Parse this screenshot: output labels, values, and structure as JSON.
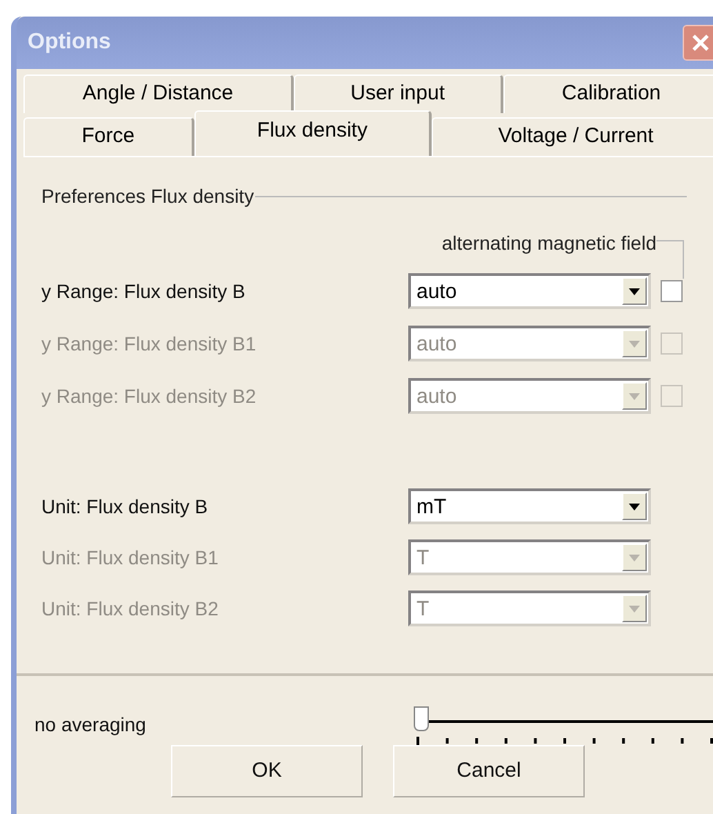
{
  "window": {
    "title": "Options"
  },
  "tab_rows": [
    {
      "tabs": [
        {
          "label": "Angle / Distance",
          "selected": false
        },
        {
          "label": "User input",
          "selected": false
        },
        {
          "label": "Calibration",
          "selected": false
        }
      ]
    },
    {
      "tabs": [
        {
          "label": "Force",
          "selected": false
        },
        {
          "label": "Flux density",
          "selected": true
        },
        {
          "label": "Voltage / Current",
          "selected": false
        }
      ]
    }
  ],
  "group": {
    "title": "Preferences Flux density",
    "column_label": "alternating magnetic field"
  },
  "range_rows": [
    {
      "label": "y Range: Flux density B",
      "value": "auto",
      "disabled": false,
      "checked": false
    },
    {
      "label": "y Range: Flux density B1",
      "value": "auto",
      "disabled": true,
      "checked": false
    },
    {
      "label": "y Range: Flux density B2",
      "value": "auto",
      "disabled": true,
      "checked": false
    }
  ],
  "unit_rows": [
    {
      "label": "Unit: Flux density B",
      "value": "mT",
      "disabled": false
    },
    {
      "label": "Unit: Flux density B1",
      "value": "T",
      "disabled": true
    },
    {
      "label": "Unit: Flux density B2",
      "value": "T",
      "disabled": true
    }
  ],
  "averaging": {
    "label": "no averaging",
    "level": 0
  },
  "buttons": [
    "OK",
    "Cancel"
  ]
}
